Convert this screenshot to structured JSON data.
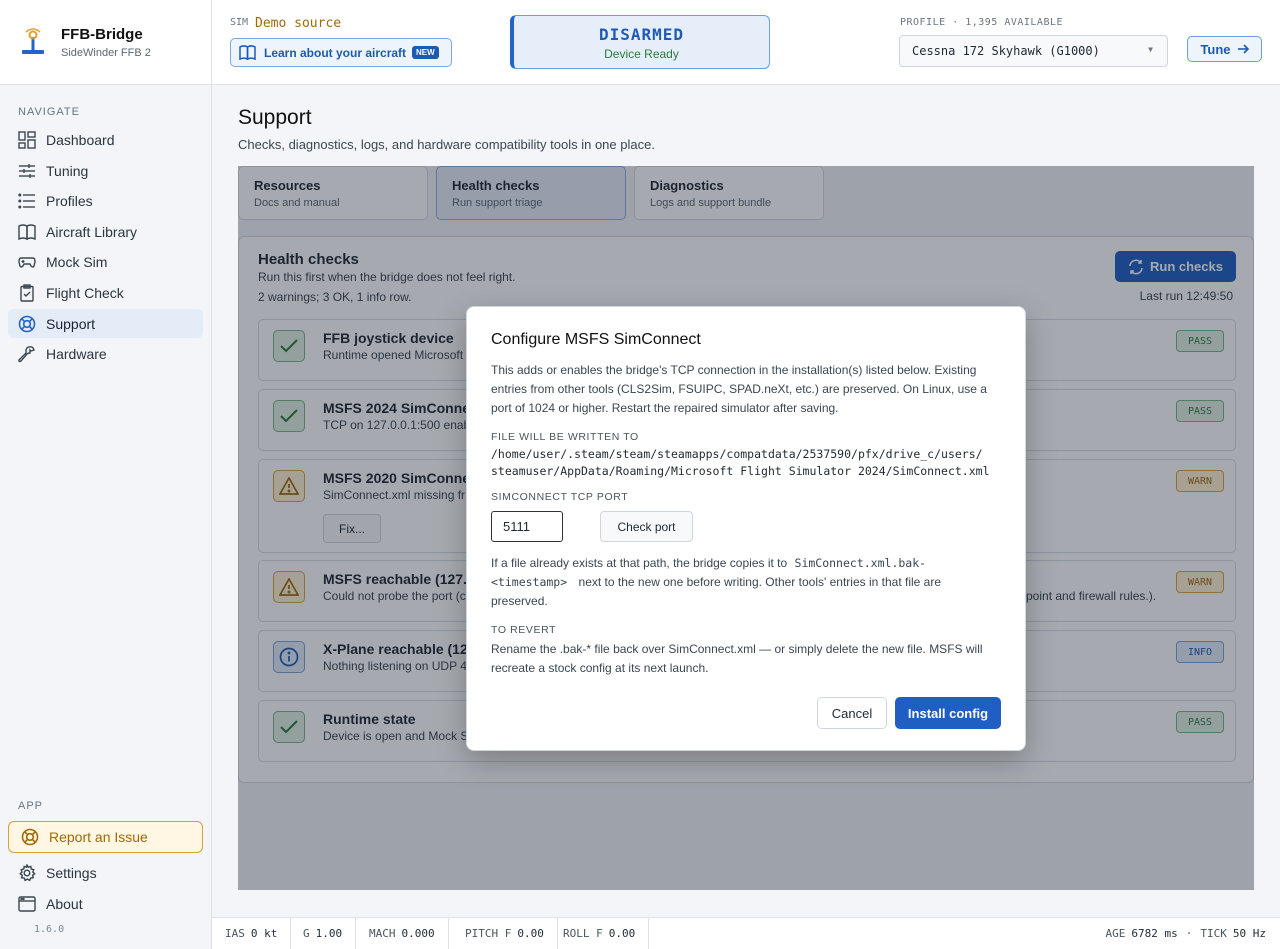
{
  "brand": {
    "name": "FFB-Bridge",
    "device": "SideWinder FFB 2"
  },
  "sidebar": {
    "navigate_label": "NAVIGATE",
    "items": [
      {
        "label": "Dashboard",
        "icon": "dashboard-icon"
      },
      {
        "label": "Tuning",
        "icon": "sliders-icon"
      },
      {
        "label": "Profiles",
        "icon": "list-icon"
      },
      {
        "label": "Aircraft Library",
        "icon": "book-icon"
      },
      {
        "label": "Mock Sim",
        "icon": "gamepad-icon"
      },
      {
        "label": "Flight Check",
        "icon": "clipboard-check-icon"
      },
      {
        "label": "Support",
        "icon": "lifebuoy-icon",
        "active": true
      },
      {
        "label": "Hardware",
        "icon": "wrench-icon"
      }
    ],
    "app_label": "APP",
    "report_issue": "Report an Issue",
    "settings": "Settings",
    "about": "About",
    "version": "1.6.0"
  },
  "header": {
    "sim_label": "SIM",
    "sim_value": "Demo source",
    "learn_label": "Learn about your aircraft",
    "new_badge": "NEW",
    "status_main": "DISARMED",
    "status_sub": "Device Ready",
    "profile_label": "PROFILE · 1,395 AVAILABLE",
    "profile_value": "Cessna 172 Skyhawk (G1000)",
    "tune_label": "Tune"
  },
  "page": {
    "title": "Support",
    "subtitle": "Checks, diagnostics, logs, and hardware compatibility tools in one place.",
    "tabs": [
      {
        "title": "Resources",
        "sub": "Docs and manual"
      },
      {
        "title": "Health checks",
        "sub": "Run support triage"
      },
      {
        "title": "Diagnostics",
        "sub": "Logs and support bundle"
      }
    ]
  },
  "health": {
    "title": "Health checks",
    "subtitle": "Run this first when the bridge does not feel right.",
    "summary": "2 warnings; 3 OK, 1 info row.",
    "run_button": "Run checks",
    "last_run": "Last run 12:49:50",
    "rows": [
      {
        "title": "FFB joystick device",
        "desc": "Runtime opened Microsoft",
        "status": "PASS",
        "kind": "ok"
      },
      {
        "title": "MSFS 2024 SimConnect",
        "desc": "TCP on 127.0.0.1:500 enabl",
        "status": "PASS",
        "kind": "ok"
      },
      {
        "title": "MSFS 2020 SimConnect",
        "desc": "SimConnect.xml missing fr",
        "status": "WARN",
        "kind": "warn",
        "fix": "Fix..."
      },
      {
        "title": "MSFS reachable (127.0.",
        "desc": "Could not probe the port (c",
        "desc_right": "point and firewall rules.).",
        "status": "WARN",
        "kind": "warn"
      },
      {
        "title": "X-Plane reachable (127.",
        "desc": "Nothing listening on UDP 4",
        "status": "INFO",
        "kind": "info"
      },
      {
        "title": "Runtime state",
        "desc": "Device is open and Mock S",
        "status": "PASS",
        "kind": "ok"
      }
    ]
  },
  "dialog": {
    "title": "Configure MSFS SimConnect",
    "body": "This adds or enables the bridge's TCP connection in the installation(s) listed below. Existing entries from other tools (CLS2Sim, FSUIPC, SPAD.neXt, etc.) are preserved. On Linux, use a port of 1024 or higher. Restart the repaired simulator after saving.",
    "file_label": "FILE WILL BE WRITTEN TO",
    "file_path_1": "/home/user/.steam/steam/steamapps/compatdata/2537590/pfx/drive_c/users/",
    "file_path_2": "steamuser/AppData/Roaming/Microsoft Flight Simulator 2024/SimConnect.xml",
    "port_label": "SIMCONNECT TCP PORT",
    "port_value": "5111",
    "check_port": "Check port",
    "note_1": "If a file already exists at that path, the bridge copies it to",
    "note_code_1": "SimConnect.xml.bak-",
    "note_code_2": "<timestamp>",
    "note_2": "next to the new one before writing. Other tools' entries in that file are preserved.",
    "revert_label": "TO REVERT",
    "revert_text": "Rename the .bak-* file back over SimConnect.xml — or simply delete the new file. MSFS will recreate a stock config at its next launch.",
    "cancel": "Cancel",
    "install": "Install config"
  },
  "statusbar": {
    "ias_k": "IAS",
    "ias_v": "0 kt",
    "g_k": "G",
    "g_v": "1.00",
    "mach_k": "MACH",
    "mach_v": "0.000",
    "pitch_k": "PITCH F",
    "pitch_v": "0.00",
    "roll_k": "ROLL F",
    "roll_v": "0.00",
    "age_k": "AGE",
    "age_v": "6782 ms",
    "sep": "·",
    "tick_k": "TICK",
    "tick_v": "50 Hz"
  }
}
